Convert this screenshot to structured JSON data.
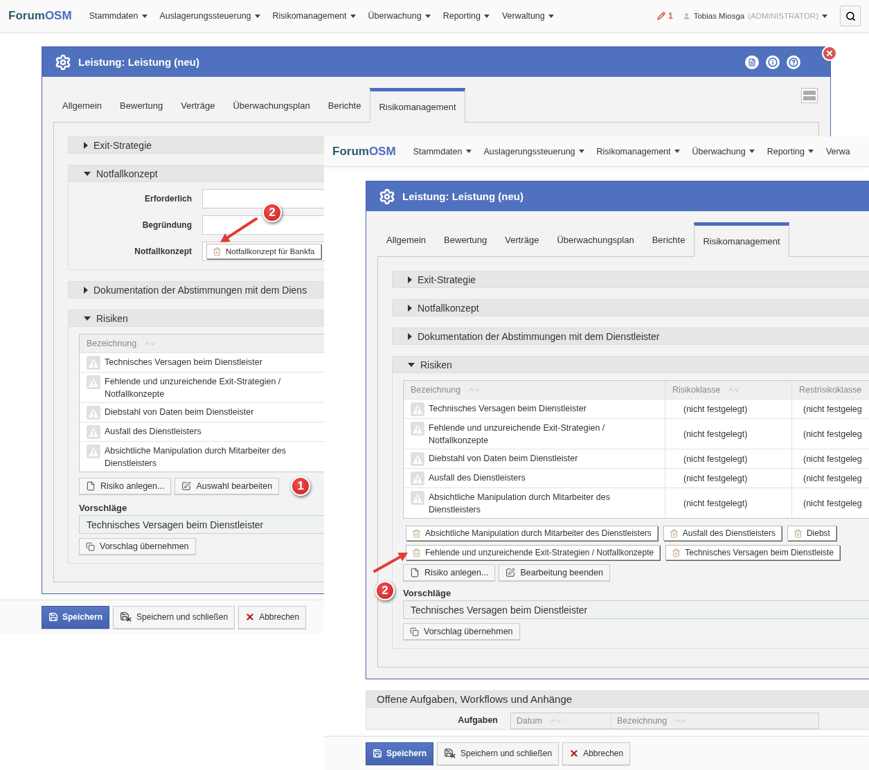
{
  "screens": [
    {
      "kind": "window",
      "navbar": {
        "brand_prefix": "Forum",
        "brand_suffix": "OSM",
        "menus": [
          {
            "label": "Stammdaten",
            "caret": true
          },
          {
            "label": "Auslagerungssteuerung",
            "caret": true
          },
          {
            "label": "Risikomanagement",
            "caret": true
          },
          {
            "label": "Überwachung",
            "caret": true
          },
          {
            "label": "Reporting",
            "caret": true
          },
          {
            "label": "Verwaltung",
            "caret": true
          }
        ],
        "notifications": "1",
        "user": "Tobias Miosga",
        "role": "(ADMINISTRATOR)"
      },
      "dialog": {
        "title": "Leistung: Leistung (neu)",
        "tabs": [
          {
            "label": "Allgemein",
            "selected": false
          },
          {
            "label": "Bewertung",
            "selected": false
          },
          {
            "label": "Verträge",
            "selected": false
          },
          {
            "label": "Überwachungsplan",
            "selected": false
          },
          {
            "label": "Berichte",
            "selected": false
          },
          {
            "label": "Risikomanagement",
            "selected": true
          }
        ],
        "sections": [
          {
            "title": "Exit-Strategie",
            "expanded": false
          },
          {
            "title": "Notfallkonzept",
            "expanded": true,
            "kind": "form",
            "fields": [
              {
                "label": "Erforderlich",
                "kind": "input"
              },
              {
                "label": "Begründung",
                "kind": "input"
              },
              {
                "label": "Notfallkonzept",
                "kind": "chips",
                "chips": [
                  {
                    "label": "Notfallkonzept für Bankfa",
                    "annotation": "2"
                  }
                ]
              }
            ]
          },
          {
            "title": "Dokumentation der Abstimmungen mit dem Diens",
            "expanded": false
          },
          {
            "title": "Risiken",
            "expanded": true,
            "kind": "risks",
            "columns": [
              {
                "label": "Bezeichnung"
              }
            ],
            "rows": [
              {
                "cells": [
                  "Technisches Versagen beim Dienstleister"
                ]
              },
              {
                "cells": [
                  "Fehlende und unzureichende Exit-Strategien / Notfallkonzepte"
                ]
              },
              {
                "cells": [
                  "Diebstahl von Daten beim Dienstleister"
                ]
              },
              {
                "cells": [
                  "Ausfall des Dienstleisters"
                ]
              },
              {
                "cells": [
                  "Absichtliche Manipulation durch Mitarbeiter des Dienstleisters"
                ]
              }
            ],
            "buttons": [
              {
                "label": "Risiko anlegen..."
              },
              {
                "label": "Auswahl bearbeiten"
              }
            ],
            "buttons_annotation": "1",
            "suggestions_label": "Vorschläge",
            "suggestion": "Technisches Versagen beim Dienstleister",
            "suggestion_button": "Vorschlag übernehmen"
          }
        ]
      },
      "footer": [
        {
          "label": "Speichern",
          "kind": "primary"
        },
        {
          "label": "Speichern und schließen",
          "kind": "save_close"
        },
        {
          "label": "Abbrechen",
          "kind": "cancel"
        }
      ]
    },
    {
      "kind": "overlay",
      "navbar": {
        "brand_prefix": "Forum",
        "brand_suffix": "OSM",
        "menus": [
          {
            "label": "Stammdaten",
            "caret": true
          },
          {
            "label": "Auslagerungssteuerung",
            "caret": true
          },
          {
            "label": "Risikomanagement",
            "caret": true
          },
          {
            "label": "Überwachung",
            "caret": true
          },
          {
            "label": "Reporting",
            "caret": true
          },
          {
            "label": "Verwa",
            "caret": false
          }
        ]
      },
      "dialog": {
        "title": "Leistung: Leistung (neu)",
        "tabs": [
          {
            "label": "Allgemein",
            "selected": false
          },
          {
            "label": "Bewertung",
            "selected": false
          },
          {
            "label": "Verträge",
            "selected": false
          },
          {
            "label": "Überwachungsplan",
            "selected": false
          },
          {
            "label": "Berichte",
            "selected": false
          },
          {
            "label": "Risikomanagement",
            "selected": true
          }
        ],
        "sections": [
          {
            "title": "Exit-Strategie",
            "expanded": false
          },
          {
            "title": "Notfallkonzept",
            "expanded": false
          },
          {
            "title": "Dokumentation der Abstimmungen mit dem Dienstleister",
            "expanded": false
          },
          {
            "title": "Risiken",
            "expanded": true,
            "kind": "risks",
            "columns": [
              {
                "label": "Bezeichnung"
              },
              {
                "label": "Risikoklasse"
              },
              {
                "label": "Restrisikoklasse"
              }
            ],
            "rows": [
              {
                "cells": [
                  "Technisches Versagen beim Dienstleister",
                  "(nicht festgelegt)",
                  "(nicht festgeleg"
                ]
              },
              {
                "cells": [
                  "Fehlende und unzureichende Exit-Strategien / Notfallkonzepte",
                  "(nicht festgelegt)",
                  "(nicht festgeleg"
                ]
              },
              {
                "cells": [
                  "Diebstahl von Daten beim Dienstleister",
                  "(nicht festgelegt)",
                  "(nicht festgeleg"
                ]
              },
              {
                "cells": [
                  "Ausfall des Dienstleisters",
                  "(nicht festgelegt)",
                  "(nicht festgeleg"
                ]
              },
              {
                "cells": [
                  "Absichtliche Manipulation durch Mitarbeiter des Dienstleisters",
                  "(nicht festgelegt)",
                  "(nicht festgeleg"
                ]
              }
            ],
            "chips": [
              {
                "label": "Absichtliche Manipulation durch Mitarbeiter des Dienstleisters"
              },
              {
                "label": "Ausfall des Dienstleisters"
              },
              {
                "label": "Diebst"
              },
              {
                "label": "Fehlende und unzureichende Exit-Strategien / Notfallkonzepte",
                "annotation": "2"
              },
              {
                "label": "Technisches Versagen beim Dienstleiste"
              }
            ],
            "buttons": [
              {
                "label": "Risiko anlegen..."
              },
              {
                "label": "Bearbeitung beenden"
              }
            ],
            "suggestions_label": "Vorschläge",
            "suggestion": "Technisches Versagen beim Dienstleister",
            "suggestion_button": "Vorschlag übernehmen"
          }
        ]
      },
      "tasks": {
        "title": "Offene Aufgaben, Workflows und Anhänge",
        "label": "Aufgaben",
        "columns": [
          "Datum",
          "Bezeichnung"
        ]
      },
      "footer": [
        {
          "label": "Speichern",
          "kind": "primary"
        },
        {
          "label": "Speichern und schließen",
          "kind": "save_close"
        },
        {
          "label": "Abbrechen",
          "kind": "cancel"
        }
      ]
    }
  ]
}
